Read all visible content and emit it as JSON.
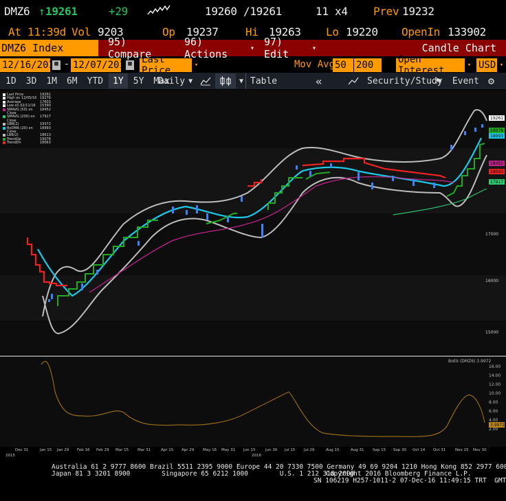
{
  "quote": {
    "ticker": "DMZ6",
    "last": "19261",
    "change": "+29",
    "bid_ask": "19260 /19261",
    "size": "11 x4",
    "prev_label": "Prev",
    "prev": "19232",
    "at_label": "At",
    "time": "11:39d",
    "vol_label": "Vol",
    "vol": "9203",
    "op_label": "Op",
    "op": "19237",
    "hi_label": "Hi",
    "hi": "19263",
    "lo_label": "Lo",
    "lo": "19220",
    "openin_label": "OpenIn",
    "openin": "133902"
  },
  "menu": {
    "index_label": "DMZ6 Index",
    "compare": "95) Compare",
    "actions": "96) Actions",
    "edit": "97) Edit",
    "chart_type": "Candle Chart"
  },
  "controls": {
    "start_date": "12/16/2015",
    "end_date": "12/07/2016",
    "price_field": "Last Price",
    "mov_avg_label": "Mov Avg",
    "mov_avg_1": "50",
    "mov_avg_2": "200",
    "oi_field": "Open Interest",
    "currency": "USD"
  },
  "toolbar": {
    "ranges": [
      "1D",
      "3D",
      "1M",
      "6M",
      "YTD",
      "1Y",
      "5Y",
      "Max"
    ],
    "selected_range": "1Y",
    "period": "Daily",
    "table": "Table",
    "security_study": "Security/Study",
    "event": "Event"
  },
  "legend": [
    {
      "label": "Last Price",
      "value": "19261",
      "color": "#ffffff"
    },
    {
      "label": "High on 12/05/16",
      "value": "19276",
      "color": "#ffffff"
    },
    {
      "label": "Average",
      "value": "17603",
      "color": "#ffffff"
    },
    {
      "label": "Low on 02/11/16",
      "value": "15390",
      "color": "#ffffff"
    },
    {
      "label": "SMAVG (50) on Close",
      "value": "18452",
      "color": "#c0238a"
    },
    {
      "label": "SMAVG (200) on Close",
      "value": "17917",
      "color": "#2ecc71"
    },
    {
      "label": "UBB(2)",
      "value": "19372",
      "color": "#bbbbbb"
    },
    {
      "label": "BoDMA (20) on Close",
      "value": "18993",
      "color": "#1ec8e8"
    },
    {
      "label": "LBB(2)",
      "value": "18613",
      "color": "#bbbbbb"
    },
    {
      "label": "TrendUp",
      "value": "19078",
      "color": "#22aa22"
    },
    {
      "label": "TrendDn",
      "value": "18063",
      "color": "#ee2222"
    }
  ],
  "price_axis": [
    "17000",
    "16000",
    "15000"
  ],
  "price_tags": [
    {
      "value": "19261",
      "color": "#ffffff"
    },
    {
      "value": "19078",
      "color": "#22aa22"
    },
    {
      "value": "18993",
      "color": "#1ec8e8"
    },
    {
      "value": "18452",
      "color": "#c0238a"
    },
    {
      "value": "18063",
      "color": "#ee2222"
    },
    {
      "value": "17917",
      "color": "#2ecc71"
    }
  ],
  "lower_panel": {
    "legend": "BoEk (DMZ6) 3.9972",
    "axis": [
      "16.00",
      "14.00",
      "12.00",
      "10.00",
      "8.00",
      "6.00",
      "4.00",
      "2.00"
    ],
    "tag": "3.9972"
  },
  "x_axis": [
    "Dec 31",
    "Jan 15",
    "Jan 29",
    "Feb 16",
    "Feb 29",
    "Mar 15",
    "Mar 31",
    "Apr 15",
    "Apr 29",
    "May 16",
    "May 31",
    "Jun 15",
    "Jun 30",
    "Jul 15",
    "Jul 29",
    "Aug 15",
    "Aug 31",
    "Sep 15",
    "Sep 30",
    "Oct 14",
    "Oct 31",
    "Nov 15",
    "Nov 30"
  ],
  "x_years": [
    "2015",
    "2016"
  ],
  "footer": {
    "line1": "Australia 61 2 9777 8600 Brazil 5511 2395 9000 Europe 44 20 7330 7500 Germany 49 69 9204 1210 Hong Kong 852 2977 6000",
    "line2": "Japan 81 3 3201 8900        Singapore 65 6212 1000        U.S. 1 212 318 2000",
    "copyright": "Copyright 2016 Bloomberg Finance L.P.",
    "sn": "SN 106219 H257-1011-2 07-Dec-16 11:49:15 TRT  GMT+3:00"
  },
  "colors": {
    "accent": "#ff9a00",
    "menu_red": "#8b0000",
    "up": "#22c55e"
  }
}
